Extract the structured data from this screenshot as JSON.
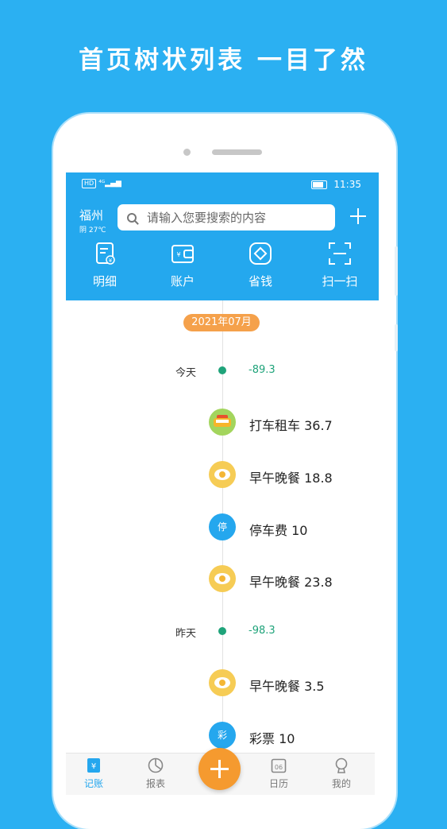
{
  "headline": "首页树状列表 一目了然",
  "status": {
    "signal": "HD 4G",
    "time": "11:35"
  },
  "header": {
    "city": "福州",
    "weather": "阴 27℃",
    "search_placeholder": "请输入您要搜索的内容"
  },
  "quick_actions": [
    {
      "label": "明细",
      "icon": "receipt-icon"
    },
    {
      "label": "账户",
      "icon": "wallet-icon"
    },
    {
      "label": "省钱",
      "icon": "coin-icon"
    },
    {
      "label": "扫一扫",
      "icon": "scan-icon"
    }
  ],
  "timeline": {
    "month": "2021年07月",
    "days": [
      {
        "label": "今天",
        "total": "-89.3",
        "entries": [
          {
            "icon": "taxi-icon",
            "text": "打车租车 36.7"
          },
          {
            "icon": "meal-icon",
            "text": "早午晚餐 18.8"
          },
          {
            "icon": "parking-icon",
            "icon_char": "停",
            "text": "停车费 10"
          },
          {
            "icon": "meal-icon",
            "text": "早午晚餐 23.8"
          }
        ]
      },
      {
        "label": "昨天",
        "total": "-98.3",
        "entries": [
          {
            "icon": "meal-icon",
            "text": "早午晚餐 3.5"
          },
          {
            "icon": "lottery-icon",
            "icon_char": "彩",
            "text": "彩票 10"
          }
        ]
      }
    ]
  },
  "tabs": [
    {
      "label": "记账",
      "icon": "ledger-icon",
      "active": true
    },
    {
      "label": "报表",
      "icon": "report-icon"
    },
    {
      "label": "日历",
      "icon": "calendar-icon",
      "day": "06"
    },
    {
      "label": "我的",
      "icon": "profile-icon"
    }
  ],
  "colors": {
    "brand": "#24a8ee",
    "accent": "#f59a2f",
    "income_expense": "#1fa37a"
  }
}
